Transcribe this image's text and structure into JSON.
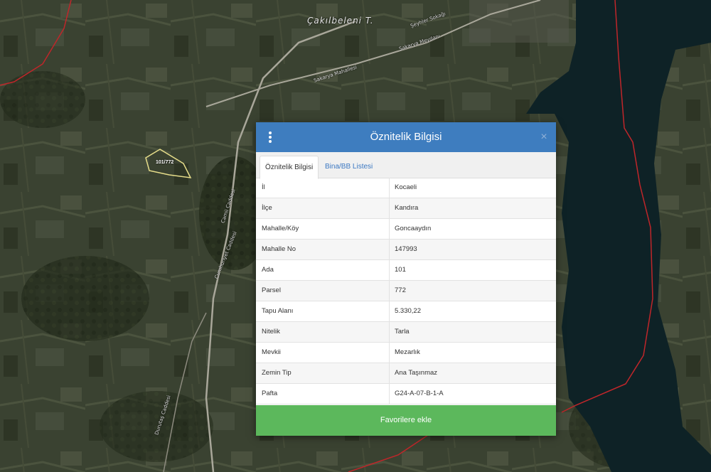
{
  "map": {
    "place_label": "Çakılbeleni T.",
    "parcel_label": "101/772",
    "road_labels": [
      "Şeyhler Sokağı",
      "Sakarya Meydanı",
      "Sakarya Mahallesi",
      "Camii Caddesi",
      "Cumhuriyet Caddesi",
      "Durutaş Caddesi"
    ],
    "colors": {
      "boundary": "#c0262a",
      "water": "#0e2226",
      "parcel": "#e6dd8a"
    }
  },
  "dialog": {
    "title": "Öznitelik Bilgisi",
    "close_symbol": "×",
    "tabs": [
      {
        "label": "Öznitelik Bilgisi",
        "active": true
      },
      {
        "label": "Bina/BB Listesi",
        "active": false
      }
    ],
    "rows": [
      {
        "key": "İl",
        "value": "Kocaeli"
      },
      {
        "key": "İlçe",
        "value": "Kandıra"
      },
      {
        "key": "Mahalle/Köy",
        "value": "Goncaaydın"
      },
      {
        "key": "Mahalle No",
        "value": "147993"
      },
      {
        "key": "Ada",
        "value": "101"
      },
      {
        "key": "Parsel",
        "value": "772"
      },
      {
        "key": "Tapu Alanı",
        "value": "5.330,22"
      },
      {
        "key": "Nitelik",
        "value": "Tarla"
      },
      {
        "key": "Mevkii",
        "value": "Mezarlık"
      },
      {
        "key": "Zemin Tip",
        "value": "Ana Taşınmaz"
      },
      {
        "key": "Pafta",
        "value": "G24-A-07-B-1-A"
      }
    ],
    "favorite_button": "Favorilere ekle",
    "colors": {
      "header": "#3e7dbf",
      "button": "#5cb85c",
      "tab_link": "#3c78c2"
    }
  }
}
